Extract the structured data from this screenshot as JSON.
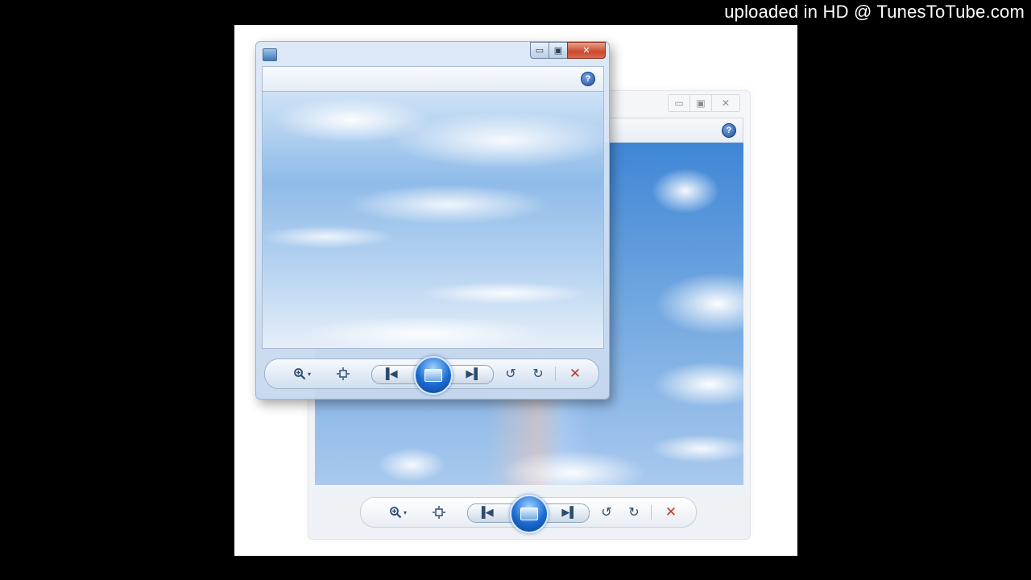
{
  "watermark": "uploaded in HD @ TunesToTube.com",
  "back_window": {
    "caption_buttons": {
      "minimize": "▭",
      "maximize": "▣",
      "close": "✕"
    },
    "help": "?",
    "toolbar": {
      "zoom_icon": "zoom-icon",
      "zoom_arrow": "▾",
      "fit_icon": "fit-window-icon",
      "prev": "▐◀",
      "next": "▶▌",
      "rotate_left": "↺",
      "rotate_right": "↻",
      "delete": "✕"
    }
  },
  "front_window": {
    "caption_buttons": {
      "minimize": "▭",
      "maximize": "▣",
      "close": "✕"
    },
    "help": "?",
    "toolbar": {
      "zoom_icon": "zoom-icon",
      "zoom_arrow": "▾",
      "fit_icon": "fit-window-icon",
      "prev": "▐◀",
      "next": "▶▌",
      "rotate_left": "↺",
      "rotate_right": "↻",
      "delete": "✕"
    }
  },
  "colors": {
    "accent": "#1b6ad0",
    "close_button": "#c94a2f",
    "delete": "#c0392b",
    "background": "#000000"
  }
}
